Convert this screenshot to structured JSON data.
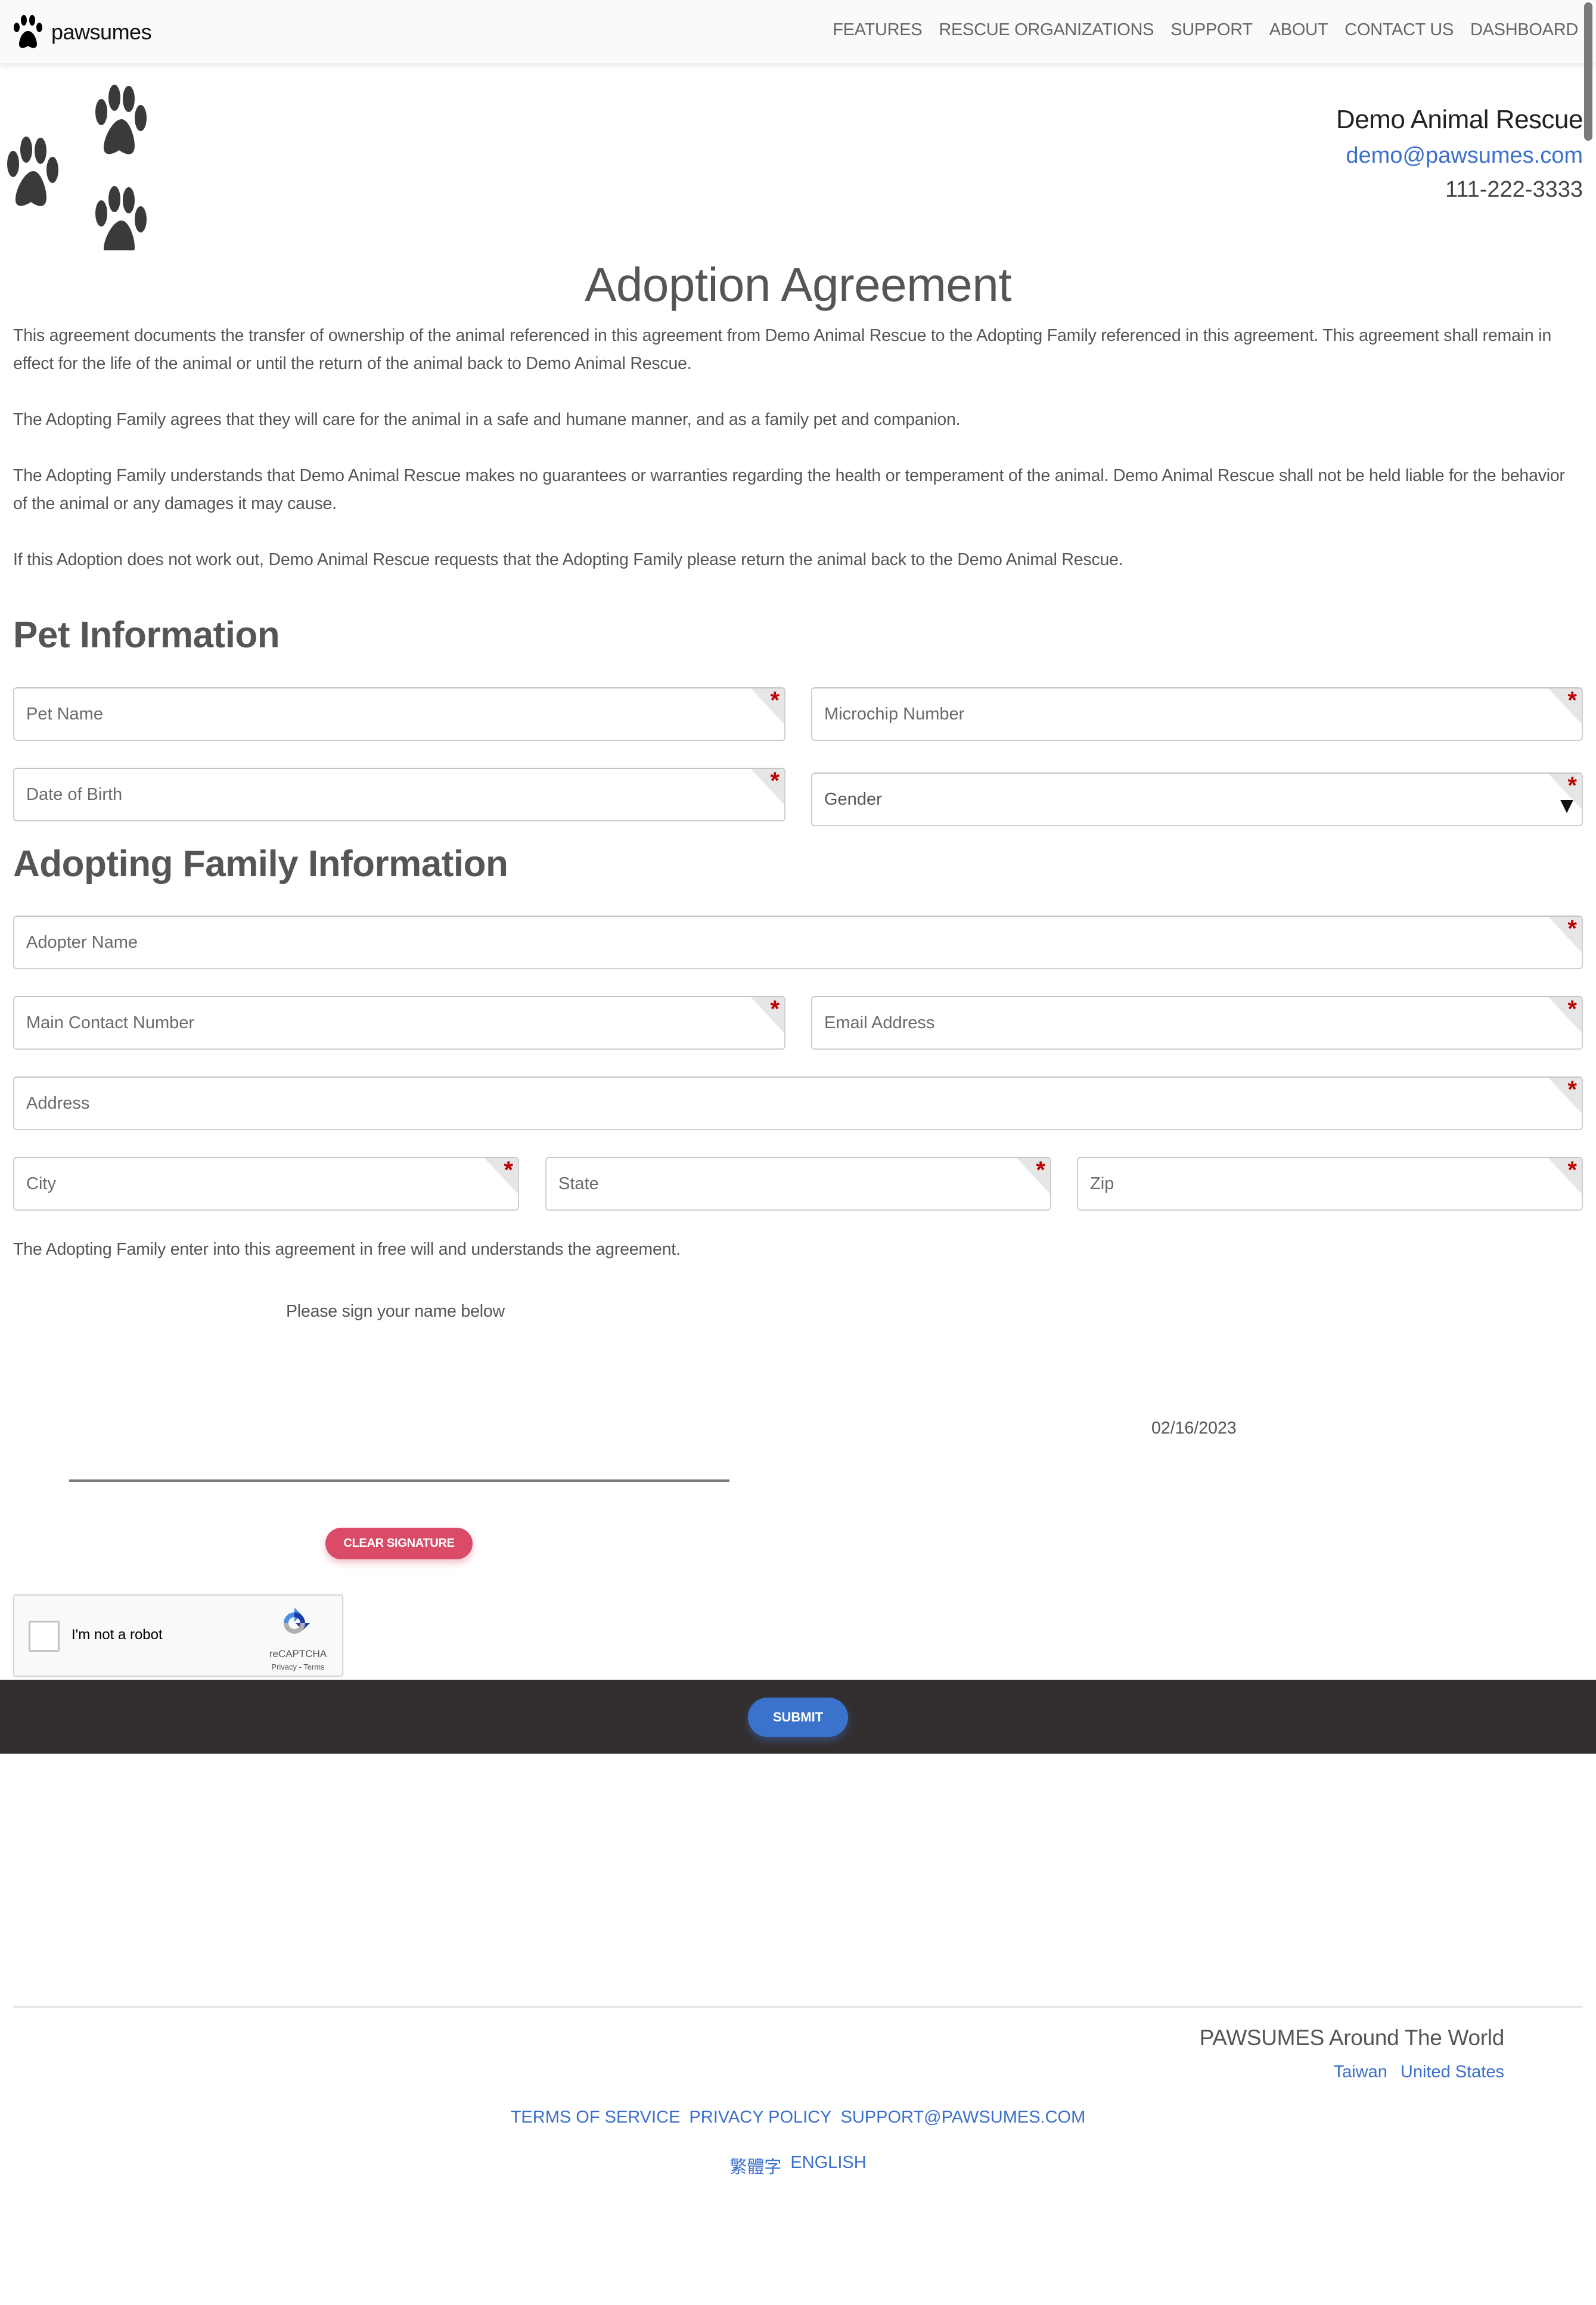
{
  "nav": {
    "brand": "pawsumes",
    "links": [
      "FEATURES",
      "RESCUE ORGANIZATIONS",
      "SUPPORT",
      "ABOUT",
      "CONTACT US",
      "DASHBOARD"
    ]
  },
  "organization": {
    "name": "Demo Animal Rescue",
    "email": "demo@pawsumes.com",
    "phone": "111-222-3333"
  },
  "title": "Adoption Agreement",
  "paragraphs": [
    "This agreement documents the transfer of ownership of the animal referenced in this agreement from Demo Animal Rescue to the Adopting Family referenced in this agreement. This agreement shall remain in effect for the life of the animal or until the return of the animal back to Demo Animal Rescue.",
    "The Adopting Family agrees that they will care for the animal in a safe and humane manner, and as a family pet and companion.",
    "The Adopting Family understands that Demo Animal Rescue makes no guarantees or warranties regarding the health or temperament of the animal. Demo Animal Rescue shall not be held liable for the behavior of the animal or any damages it may cause.",
    "If this Adoption does not work out, Demo Animal Rescue requests that the Adopting Family please return the animal back to the Demo Animal Rescue."
  ],
  "pet_section": {
    "heading": "Pet Information",
    "fields": {
      "pet_name": {
        "placeholder": "Pet Name",
        "value": "",
        "required": true
      },
      "microchip": {
        "placeholder": "Microchip Number",
        "value": "",
        "required": true
      },
      "dob": {
        "placeholder": "Date of Birth",
        "value": "",
        "required": true
      },
      "gender": {
        "selected": "Gender",
        "required": true
      }
    }
  },
  "family_section": {
    "heading": "Adopting Family Information",
    "fields": {
      "adopter_name": {
        "placeholder": "Adopter Name",
        "value": "",
        "required": true
      },
      "contact_number": {
        "placeholder": "Main Contact Number",
        "value": "",
        "required": true
      },
      "email": {
        "placeholder": "Email Address",
        "value": "",
        "required": true
      },
      "address": {
        "placeholder": "Address",
        "value": "",
        "required": true
      },
      "city": {
        "placeholder": "City",
        "value": "",
        "required": true
      },
      "state": {
        "placeholder": "State",
        "value": "",
        "required": true
      },
      "zip": {
        "placeholder": "Zip",
        "value": "",
        "required": true
      }
    }
  },
  "signature": {
    "agreement_text": "The Adopting Family enter into this agreement in free will and understands the agreement.",
    "prompt": "Please sign your name below",
    "date": "02/16/2023",
    "clear_label": "CLEAR SIGNATURE"
  },
  "captcha": {
    "label": "I'm not a robot",
    "brand": "reCAPTCHA",
    "privacy": "Privacy",
    "separator": " - ",
    "terms": "Terms",
    "checked": false
  },
  "submit_label": "SUBMIT",
  "footer": {
    "heading": "PAWSUMES Around The World",
    "countries": [
      "Taiwan",
      "United States"
    ],
    "links": [
      "TERMS OF SERVICE",
      "PRIVACY POLICY",
      "SUPPORT@PAWSUMES.COM"
    ],
    "languages": [
      "繁體字",
      "ENGLISH"
    ]
  },
  "colors": {
    "link": "#3a6fca",
    "required": "#c00000",
    "clear_button": "#d94b66",
    "submit_button": "#3a72cc",
    "submit_bar": "#332e2e"
  }
}
